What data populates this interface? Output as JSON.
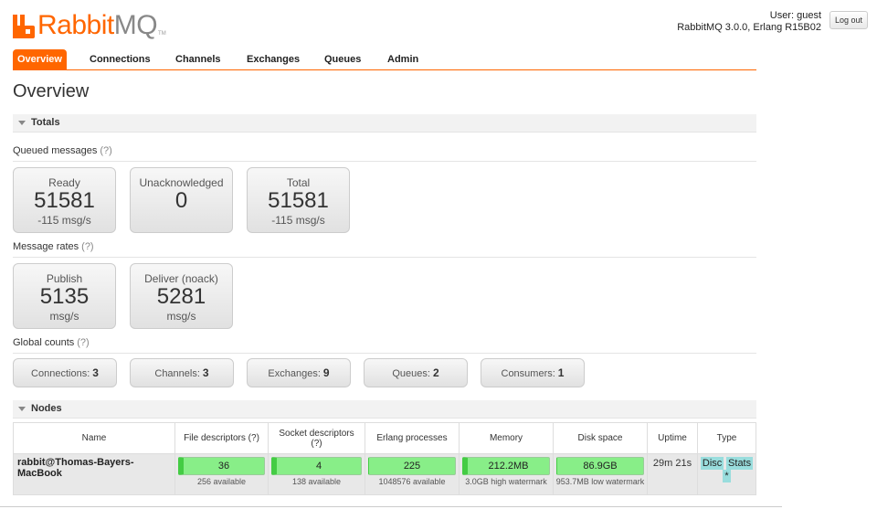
{
  "logo": {
    "rabbit": "Rabbit",
    "mq": "MQ",
    "tm": "TM"
  },
  "user": {
    "label": "User: guest",
    "version": "RabbitMQ 3.0.0, Erlang R15B02",
    "logout": "Log out"
  },
  "tabs": [
    "Overview",
    "Connections",
    "Channels",
    "Exchanges",
    "Queues",
    "Admin"
  ],
  "page_title": "Overview",
  "totals": {
    "section": "Totals",
    "queued_label": "Queued messages",
    "help": "(?)",
    "queued": [
      {
        "title": "Ready",
        "value": "51581",
        "rate": "-115 msg/s"
      },
      {
        "title": "Unacknowledged",
        "value": "0",
        "rate": ""
      },
      {
        "title": "Total",
        "value": "51581",
        "rate": "-115 msg/s"
      }
    ],
    "rates_label": "Message rates",
    "rates": [
      {
        "title": "Publish",
        "value": "5135",
        "rate": "msg/s"
      },
      {
        "title": "Deliver (noack)",
        "value": "5281",
        "rate": "msg/s"
      }
    ],
    "global_label": "Global counts",
    "global": [
      {
        "label": "Connections:",
        "value": "3"
      },
      {
        "label": "Channels:",
        "value": "3"
      },
      {
        "label": "Exchanges:",
        "value": "9"
      },
      {
        "label": "Queues:",
        "value": "2"
      },
      {
        "label": "Consumers:",
        "value": "1"
      }
    ]
  },
  "nodes": {
    "section": "Nodes",
    "headers": {
      "name": "Name",
      "fd": "File descriptors",
      "fd_help": "(?)",
      "sd": "Socket descriptors",
      "sd_help": "(?)",
      "ep": "Erlang processes",
      "mem": "Memory",
      "disk": "Disk space",
      "uptime": "Uptime",
      "type": "Type"
    },
    "row": {
      "name": "rabbit@Thomas-Bayers-MacBook",
      "fd": "36",
      "fd_sub": "256 available",
      "sd": "4",
      "sd_sub": "138 available",
      "ep": "225",
      "ep_sub": "1048576 available",
      "mem": "212.2MB",
      "mem_sub": "3.0GB high watermark",
      "disk": "86.9GB",
      "disk_sub": "953.7MB low watermark",
      "uptime": "29m 21s",
      "type_disc": "Disc",
      "type_stats": "Stats",
      "type_star": "*"
    }
  }
}
